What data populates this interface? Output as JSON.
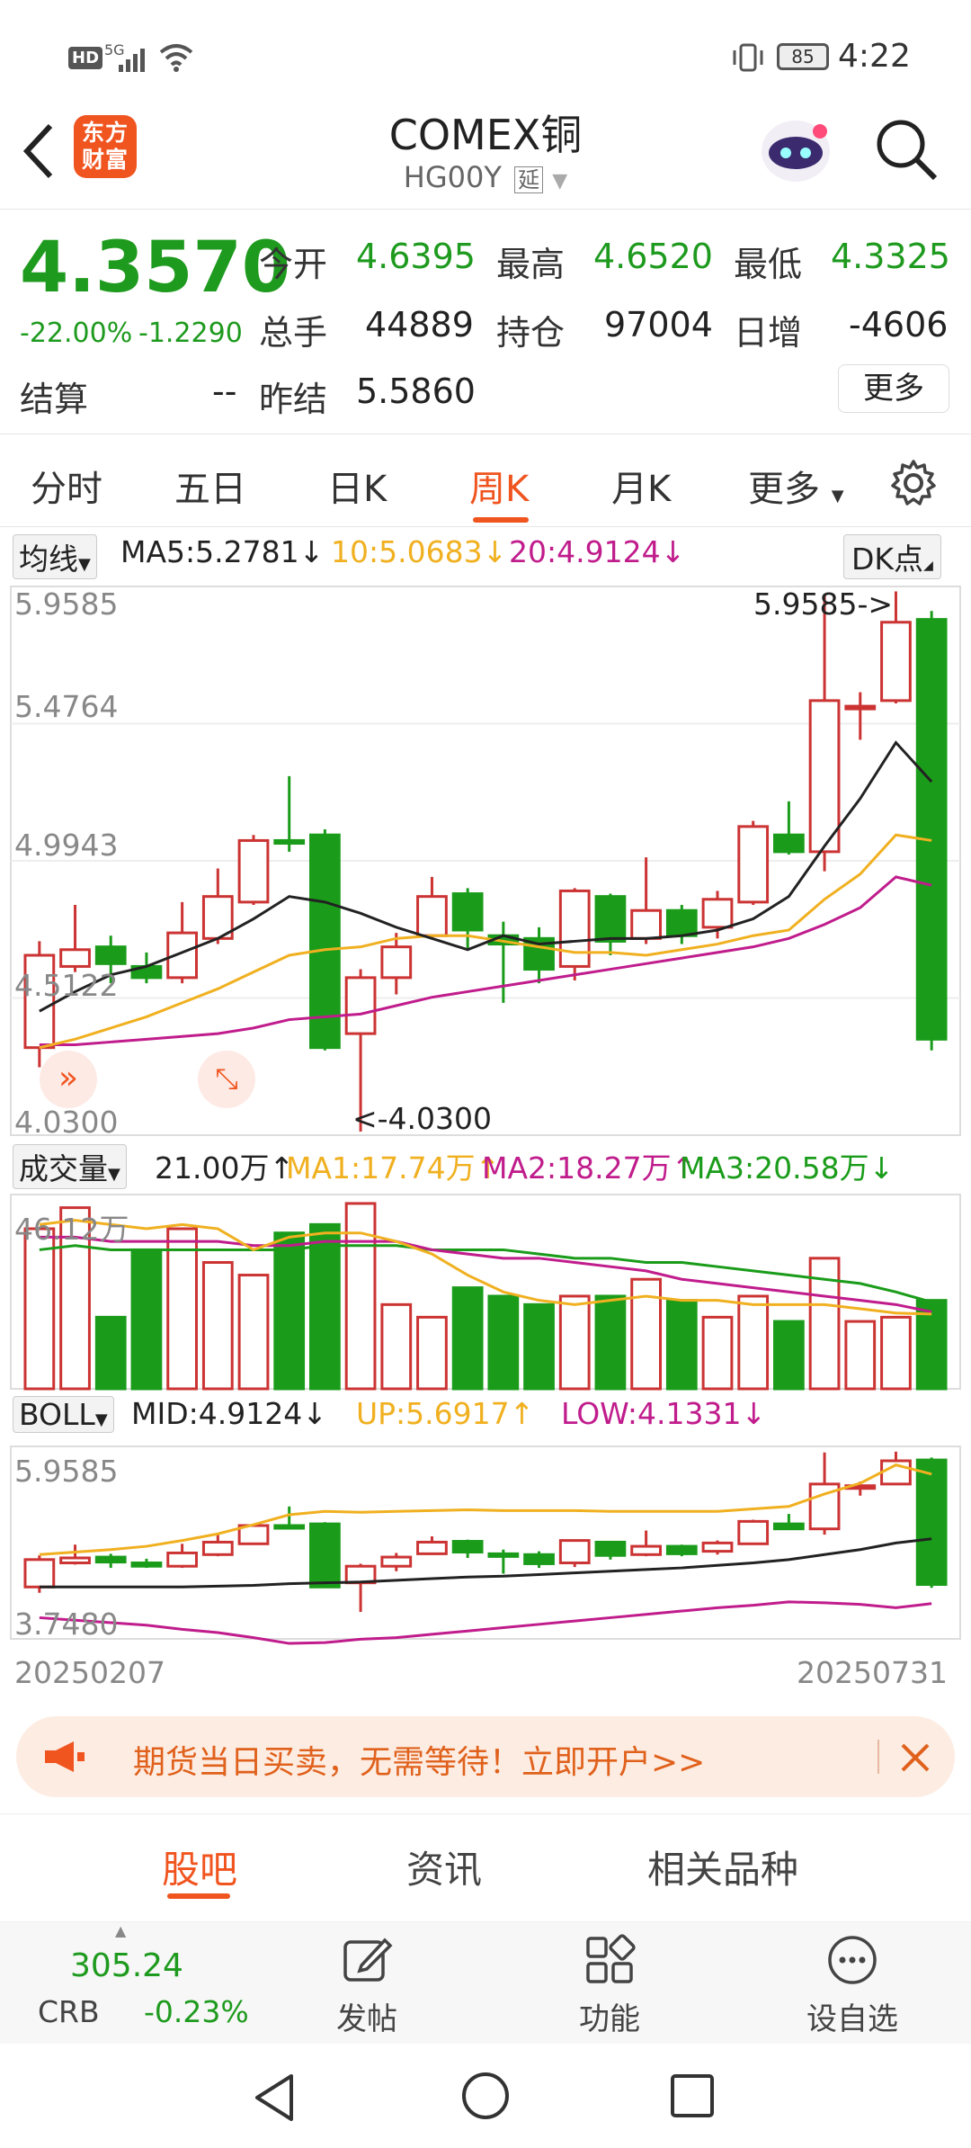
{
  "status": {
    "time": "4:22",
    "battery": "85",
    "network": "5G",
    "hd": "HD"
  },
  "header": {
    "title": "COMEX铜",
    "code": "HG00Y",
    "code_tag": "延",
    "logo_line1": "东方",
    "logo_line2": "财富"
  },
  "quote": {
    "price": "4.3570",
    "pct": "-22.00%",
    "chg": "-1.2290",
    "open_label": "今开",
    "open": "4.6395",
    "high_label": "最高",
    "high": "4.6520",
    "low_label": "最低",
    "low": "4.3325",
    "vol_label": "总手",
    "vol": "44889",
    "oi_label": "持仓",
    "oi": "97004",
    "dinc_label": "日增",
    "dinc": "-4606",
    "settle_label": "结算",
    "settle": "--",
    "prev_label": "昨结",
    "prev": "5.5860",
    "more": "更多"
  },
  "tabs": [
    "分时",
    "五日",
    "日K",
    "周K",
    "月K",
    "更多"
  ],
  "active_tab": "周K",
  "indicators": {
    "ma_label": "均线",
    "ma5": "MA5:5.2781↓",
    "ma10": "10:5.0683↓",
    "ma20": "20:4.9124↓",
    "dk": "DK点",
    "vol_label": "成交量",
    "vol_now": "21.00万↑",
    "vma1": "MA1:17.74万↑",
    "vma2": "MA2:18.27万↑",
    "vma3": "MA3:20.58万↓",
    "vol_max": "46.12万",
    "boll_label": "BOLL",
    "mid": "MID:4.9124↓",
    "up": "UP:5.6917↑",
    "lowb": "LOW:4.1331↓",
    "boll_top": "5.9585",
    "boll_bottom": "3.7480",
    "date_start": "20250207",
    "date_end": "20250731"
  },
  "chart_data": {
    "type": "candlestick",
    "y_ticks": [
      "5.9585",
      "5.4764",
      "4.9943",
      "4.5122",
      "4.0300"
    ],
    "ylim": [
      4.03,
      5.9585
    ],
    "max_label": "5.9585->",
    "min_label": "<-4.0300",
    "candles": [
      {
        "o": 4.33,
        "c": 4.66,
        "h": 4.71,
        "l": 4.26
      },
      {
        "o": 4.62,
        "c": 4.68,
        "h": 4.84,
        "l": 4.6
      },
      {
        "o": 4.69,
        "c": 4.63,
        "h": 4.73,
        "l": 4.56
      },
      {
        "o": 4.62,
        "c": 4.58,
        "h": 4.67,
        "l": 4.56
      },
      {
        "o": 4.58,
        "c": 4.74,
        "h": 4.85,
        "l": 4.56
      },
      {
        "o": 4.72,
        "c": 4.87,
        "h": 4.97,
        "l": 4.7
      },
      {
        "o": 4.85,
        "c": 5.07,
        "h": 5.09,
        "l": 4.84
      },
      {
        "o": 5.07,
        "c": 5.06,
        "h": 5.3,
        "l": 5.03
      },
      {
        "o": 5.09,
        "c": 4.33,
        "h": 5.11,
        "l": 4.32
      },
      {
        "o": 4.38,
        "c": 4.58,
        "h": 4.61,
        "l": 4.03
      },
      {
        "o": 4.58,
        "c": 4.69,
        "h": 4.74,
        "l": 4.52
      },
      {
        "o": 4.73,
        "c": 4.87,
        "h": 4.94,
        "l": 4.72
      },
      {
        "o": 4.88,
        "c": 4.75,
        "h": 4.9,
        "l": 4.68
      },
      {
        "o": 4.73,
        "c": 4.7,
        "h": 4.78,
        "l": 4.49
      },
      {
        "o": 4.72,
        "c": 4.61,
        "h": 4.76,
        "l": 4.56
      },
      {
        "o": 4.62,
        "c": 4.89,
        "h": 4.9,
        "l": 4.57
      },
      {
        "o": 4.87,
        "c": 4.71,
        "h": 4.88,
        "l": 4.66
      },
      {
        "o": 4.72,
        "c": 4.82,
        "h": 5.01,
        "l": 4.7
      },
      {
        "o": 4.82,
        "c": 4.73,
        "h": 4.84,
        "l": 4.7
      },
      {
        "o": 4.76,
        "c": 4.86,
        "h": 4.89,
        "l": 4.72
      },
      {
        "o": 4.85,
        "c": 5.12,
        "h": 5.14,
        "l": 4.84
      },
      {
        "o": 5.09,
        "c": 5.03,
        "h": 5.21,
        "l": 5.02
      },
      {
        "o": 5.03,
        "c": 5.57,
        "h": 5.95,
        "l": 4.96
      },
      {
        "o": 5.55,
        "c": 5.55,
        "h": 5.6,
        "l": 5.43
      },
      {
        "o": 5.57,
        "c": 5.85,
        "h": 5.96,
        "l": 5.56
      },
      {
        "o": 5.86,
        "c": 4.36,
        "h": 5.89,
        "l": 4.32
      }
    ],
    "ma5": [
      4.46,
      4.53,
      4.59,
      4.62,
      4.67,
      4.72,
      4.79,
      4.87,
      4.85,
      4.81,
      4.76,
      4.72,
      4.68,
      4.73,
      4.7,
      4.71,
      4.72,
      4.72,
      4.73,
      4.75,
      4.79,
      4.87,
      5.05,
      5.22,
      5.42,
      5.28
    ],
    "ma10": [
      4.33,
      4.36,
      4.4,
      4.44,
      4.49,
      4.54,
      4.6,
      4.66,
      4.68,
      4.69,
      4.72,
      4.73,
      4.73,
      4.71,
      4.69,
      4.67,
      4.67,
      4.66,
      4.68,
      4.7,
      4.73,
      4.75,
      4.86,
      4.95,
      5.09,
      5.07
    ],
    "ma20": [
      4.34,
      4.34,
      4.35,
      4.36,
      4.37,
      4.38,
      4.4,
      4.43,
      4.44,
      4.45,
      4.48,
      4.51,
      4.53,
      4.55,
      4.57,
      4.59,
      4.61,
      4.63,
      4.65,
      4.67,
      4.69,
      4.72,
      4.77,
      4.83,
      4.94,
      4.91
    ],
    "volume": [
      38.0,
      43.0,
      17.0,
      33.0,
      38.0,
      30.0,
      27.0,
      37.0,
      39.0,
      44.0,
      20.0,
      17.0,
      24.0,
      22.0,
      20.0,
      22.0,
      22.0,
      26.0,
      21.0,
      17.0,
      22.0,
      16.0,
      31.0,
      16.0,
      17.0,
      21.0
    ],
    "vma1": [
      39.0,
      40.0,
      39.0,
      38.0,
      39.0,
      38.0,
      33.0,
      36.0,
      37.0,
      37.0,
      35.0,
      32.0,
      27.0,
      23.0,
      21.0,
      20.0,
      21.0,
      22.0,
      21.0,
      21.0,
      20.0,
      20.0,
      20.0,
      19.0,
      18.0,
      17.74
    ],
    "vma2": [
      36.0,
      36.0,
      35.0,
      35.0,
      35.0,
      35.0,
      34.0,
      34.0,
      35.0,
      35.0,
      35.0,
      33.0,
      32.0,
      31.0,
      31.0,
      30.0,
      29.0,
      28.0,
      26.0,
      25.0,
      24.0,
      23.0,
      22.0,
      21.0,
      20.0,
      18.27
    ],
    "vma3": [
      33.0,
      34.0,
      33.0,
      33.0,
      33.0,
      33.0,
      33.0,
      33.0,
      34.0,
      34.0,
      34.0,
      33.0,
      33.0,
      33.0,
      32.0,
      31.0,
      31.0,
      30.0,
      30.0,
      29.0,
      28.0,
      27.0,
      26.0,
      25.0,
      23.0,
      20.58
    ],
    "boll_mid": [
      4.33,
      4.33,
      4.33,
      4.33,
      4.33,
      4.34,
      4.35,
      4.37,
      4.38,
      4.39,
      4.41,
      4.43,
      4.45,
      4.46,
      4.48,
      4.5,
      4.52,
      4.54,
      4.56,
      4.59,
      4.62,
      4.66,
      4.72,
      4.78,
      4.86,
      4.91
    ],
    "boll_up": [
      4.72,
      4.75,
      4.78,
      4.82,
      4.89,
      4.97,
      5.08,
      5.2,
      5.24,
      5.23,
      5.24,
      5.25,
      5.26,
      5.25,
      5.25,
      5.25,
      5.24,
      5.24,
      5.24,
      5.24,
      5.27,
      5.3,
      5.45,
      5.58,
      5.8,
      5.69
    ],
    "boll_low": [
      3.96,
      3.93,
      3.9,
      3.87,
      3.82,
      3.78,
      3.72,
      3.65,
      3.66,
      3.7,
      3.72,
      3.76,
      3.8,
      3.84,
      3.88,
      3.92,
      3.96,
      4.0,
      4.04,
      4.08,
      4.11,
      4.15,
      4.14,
      4.12,
      4.08,
      4.13
    ],
    "boll_ylim": [
      3.748,
      5.9585
    ]
  },
  "banner": {
    "text": "期货当日买卖，无需等待！立即开户>>"
  },
  "bottom_tabs": [
    "股吧",
    "资讯",
    "相关品种"
  ],
  "bottom_active": "股吧",
  "toolbar": {
    "crb_value": "305.24",
    "crb_name": "CRB",
    "crb_pct": "-0.23%",
    "post": "发帖",
    "func": "功能",
    "watch": "设自选"
  },
  "colors": {
    "up": "#cc3333",
    "down": "#1a9c1a",
    "ma5": "#222222",
    "ma10": "#f0b020",
    "ma20": "#c01c8c",
    "accent": "#f0541f"
  }
}
